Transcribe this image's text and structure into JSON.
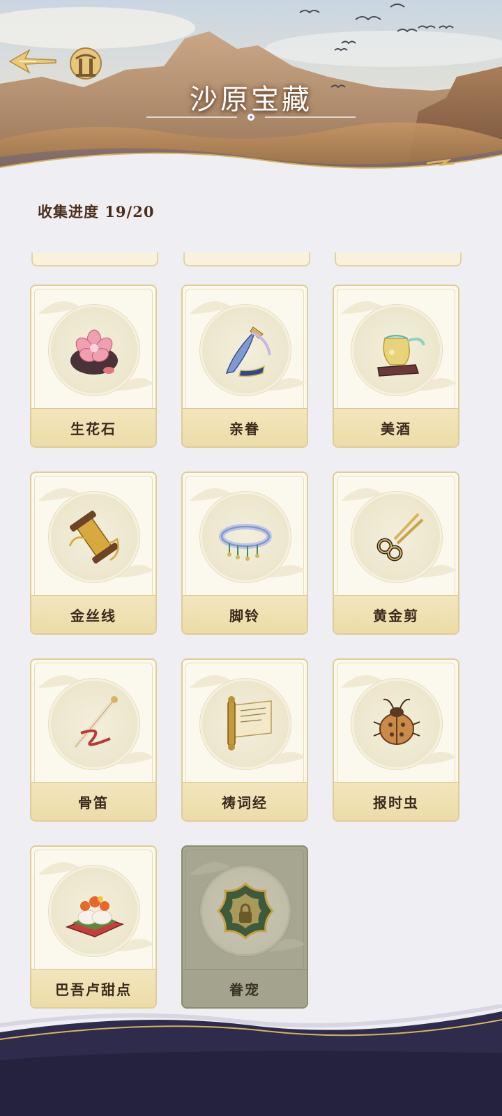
{
  "header": {
    "title": "沙原宝藏",
    "back_icon": "arrow-left-icon",
    "gate_icon": "gate-icon"
  },
  "progress": {
    "label": "收集进度",
    "collected": 19,
    "total": 20,
    "text": "收集进度 19/20"
  },
  "items": [
    {
      "name": "生花石",
      "icon": "flower-stone-icon",
      "unlocked": true
    },
    {
      "name": "亲眷",
      "icon": "dagger-icon",
      "unlocked": true
    },
    {
      "name": "美酒",
      "icon": "wine-jug-icon",
      "unlocked": true
    },
    {
      "name": "金丝线",
      "icon": "golden-thread-spool-icon",
      "unlocked": true
    },
    {
      "name": "脚铃",
      "icon": "anklet-icon",
      "unlocked": true
    },
    {
      "name": "黄金剪",
      "icon": "golden-scissors-icon",
      "unlocked": true
    },
    {
      "name": "骨笛",
      "icon": "bone-flute-icon",
      "unlocked": true
    },
    {
      "name": "祷词经",
      "icon": "scroll-icon",
      "unlocked": true
    },
    {
      "name": "报时虫",
      "icon": "beetle-icon",
      "unlocked": true
    },
    {
      "name": "巴吾卢甜点",
      "icon": "dessert-icon",
      "unlocked": true
    },
    {
      "name": "眷宠",
      "icon": "ornate-lock-icon",
      "unlocked": false
    }
  ],
  "colors": {
    "background": "#efeff3",
    "card_bg": "#fbf8ee",
    "card_border": "#dfcc97",
    "label_bar": "#ecdca8",
    "locked_card": "#a7a690",
    "footer_navy": "#2e2b4c",
    "gold_accent": "#d8b461"
  }
}
